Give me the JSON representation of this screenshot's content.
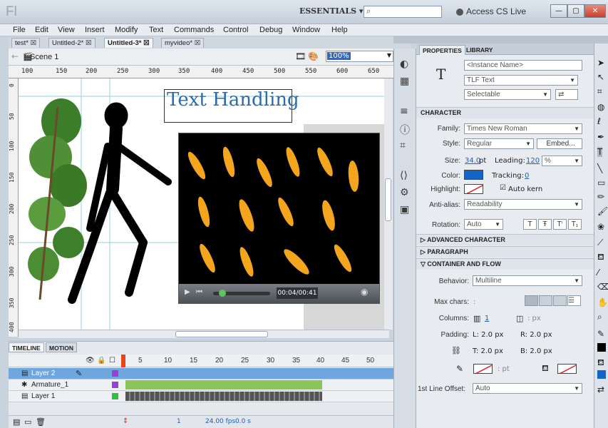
{
  "app": {
    "logo": "Fl",
    "workspace": "ESSENTIALS ▾",
    "cs_live": "Access CS Live",
    "window_min": "—",
    "window_max": "▢",
    "window_close": "✕"
  },
  "menu": [
    "File",
    "Edit",
    "View",
    "Insert",
    "Modify",
    "Text",
    "Commands",
    "Control",
    "Debug",
    "Window",
    "Help"
  ],
  "tabs": [
    {
      "label": "test* ☒"
    },
    {
      "label": "Untitled-2* ☒"
    },
    {
      "label": "Untitled-3* ☒"
    },
    {
      "label": "myvideo* ☒"
    }
  ],
  "scene": {
    "label": "Scene 1",
    "zoom": "100%"
  },
  "ruler": {
    "top": [
      "100",
      "150",
      "200",
      "250",
      "300",
      "350",
      "400",
      "450",
      "500",
      "550",
      "600",
      "650"
    ],
    "left": [
      "0",
      "50",
      "100",
      "150",
      "200",
      "250",
      "300",
      "350",
      "400"
    ]
  },
  "stage": {
    "text": "Text Handling",
    "video_time": "00:04/00:41"
  },
  "timeline": {
    "tabs": [
      "TIMELINE",
      "MOTION EDITOR"
    ],
    "frames": [
      "5",
      "10",
      "15",
      "20",
      "25",
      "30",
      "35",
      "40",
      "45",
      "50"
    ],
    "layers": [
      {
        "name": "Layer 2",
        "color": "#9b3fd6"
      },
      {
        "name": "Armature_1",
        "color": "#9b3fd6"
      },
      {
        "name": "Layer 1",
        "color": "#2fbf3a"
      }
    ],
    "footer": {
      "frame": "1",
      "fps": "24.00 fps",
      "time": "0.0 s"
    }
  },
  "panel": {
    "tabs": [
      "PROPERTIES",
      "LIBRARY"
    ],
    "instance_placeholder": "<Instance Name>",
    "text_type": "TLF Text",
    "selectable": "Selectable",
    "character": {
      "title": "CHARACTER",
      "family_label": "Family:",
      "family": "Times New Roman",
      "style_label": "Style:",
      "style": "Regular",
      "embed": "Embed...",
      "size_label": "Size:",
      "size": "34.0",
      "size_unit": "pt",
      "leading_label": "Leading:",
      "leading": "120",
      "leading_unit": "%",
      "color_label": "Color:",
      "tracking_label": "Tracking:",
      "tracking": "0",
      "highlight_label": "Highlight:",
      "autokern": "Auto kern",
      "antialias_label": "Anti-alias:",
      "antialias": "Readability",
      "rotation_label": "Rotation:",
      "rotation": "Auto"
    },
    "sections": [
      "ADVANCED CHARACTER",
      "PARAGRAPH",
      "CONTAINER AND FLOW"
    ],
    "flow": {
      "behavior_label": "Behavior:",
      "behavior": "Multiline",
      "maxchars_label": "Max chars:",
      "maxchars": ":",
      "columns_label": "Columns:",
      "columns": "1",
      "columns_px": ": px",
      "padding_label": "Padding:",
      "pad_l": "L: 2.0 px",
      "pad_r": "R: 2.0 px",
      "pad_t": "T: 2.0 px",
      "pad_b": "B: 2.0 px",
      "stroke_pt": ": pt",
      "offset_label": "1st Line Offset:",
      "offset": "Auto"
    }
  },
  "colors": {
    "accent": "#3168c0",
    "text_color": "#1565c8"
  }
}
